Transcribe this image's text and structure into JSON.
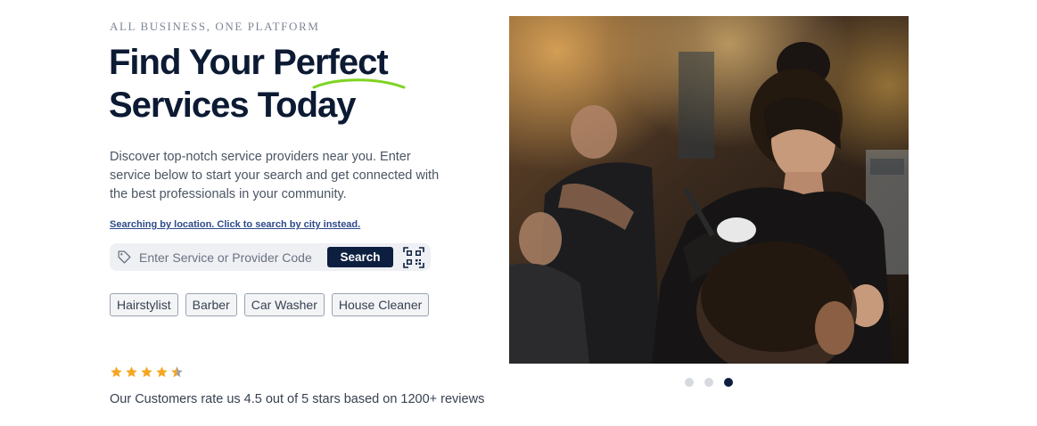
{
  "hero": {
    "eyebrow": "ALL BUSINESS, ONE PLATFORM",
    "headline_line1": "Find Your Perfect",
    "headline_line2": "Services Today",
    "description": "Discover top-notch service providers near you. Enter service below to start your search and get connected with the best professionals in your community.",
    "accent_color": "#7ed321",
    "text_color": "#0c1a33"
  },
  "search": {
    "location_link": "Searching by location. Click to search by city instead.",
    "placeholder": "Enter Service or Provider Code",
    "value": "",
    "button_label": "Search",
    "button_color": "#0c1f3f",
    "left_icon": "tag-icon",
    "right_icon": "qr-code-icon"
  },
  "categories": [
    {
      "label": "Hairstylist"
    },
    {
      "label": "Barber"
    },
    {
      "label": "Car Washer"
    },
    {
      "label": "House Cleaner"
    }
  ],
  "rating": {
    "stars": 4.5,
    "max": 5,
    "star_color": "#f5a623",
    "text": "Our Customers rate us 4.5 out of 5 stars based on 1200+ reviews"
  },
  "carousel": {
    "slide_count": 3,
    "active_index": 2,
    "image_description_icon": "barber-photo",
    "active_color": "#0c1f3f",
    "inactive_color": "#d6d9e0"
  }
}
